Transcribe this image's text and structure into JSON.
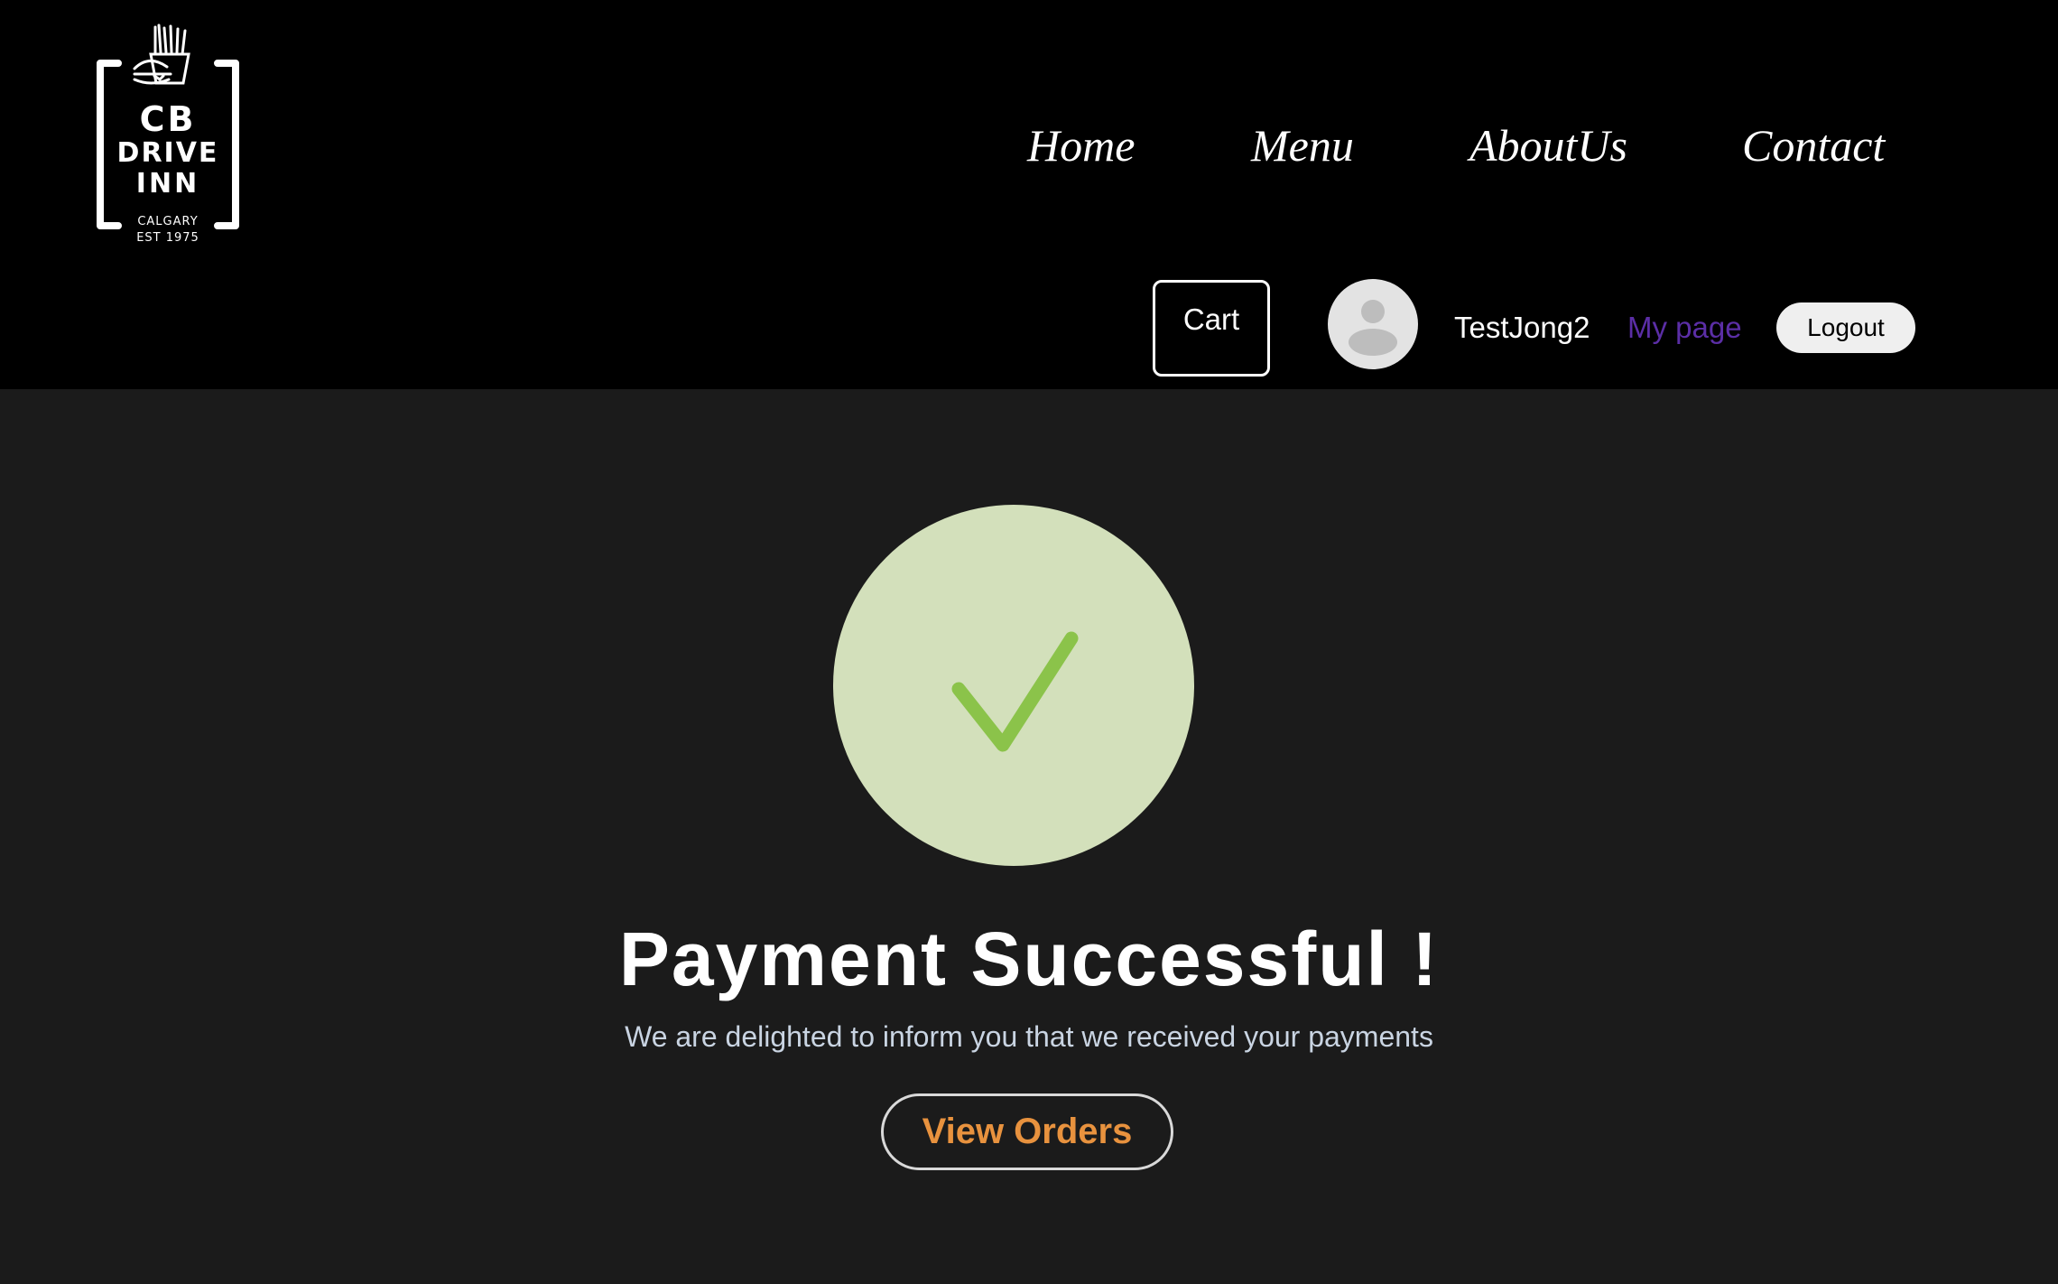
{
  "logo": {
    "line1": "CB",
    "line2": "DRIVE",
    "line3": "INN",
    "city": "CALGARY",
    "est": "EST 1975",
    "icon": "burger-fries-icon"
  },
  "nav": {
    "items": [
      {
        "label": "Home"
      },
      {
        "label": "Menu"
      },
      {
        "label": "AboutUs"
      },
      {
        "label": "Contact"
      }
    ]
  },
  "user_bar": {
    "cart_label": "Cart",
    "avatar_icon": "user-avatar-icon",
    "username": "TestJong2",
    "mypage_label": "My page",
    "logout_label": "Logout"
  },
  "main": {
    "status_icon": "checkmark-icon",
    "title": "Payment Successful !",
    "message": "We are delighted to inform you that we received your payments",
    "button_label": "View Orders"
  },
  "colors": {
    "header_bg": "#000000",
    "page_bg": "#1b1b1b",
    "success_circle": "#d3e0bb",
    "checkmark": "#8bc34a",
    "link": "#5b2ea6",
    "button_text": "#e8923e"
  }
}
